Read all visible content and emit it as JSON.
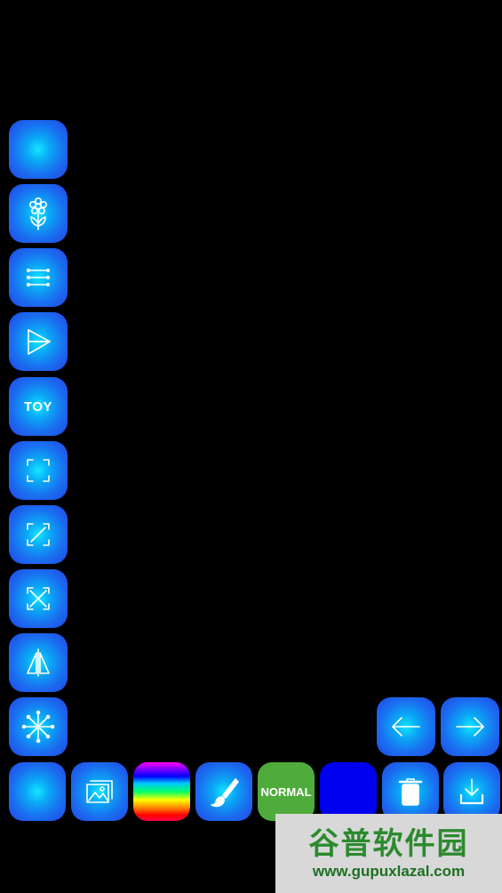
{
  "left_toolbar": {
    "items": [
      {
        "name": "plain-button",
        "icon": "glow-icon"
      },
      {
        "name": "flower-button",
        "icon": "flower-icon"
      },
      {
        "name": "lines-button",
        "icon": "lines-icon"
      },
      {
        "name": "triangle-button",
        "icon": "triangle-icon"
      },
      {
        "name": "toy-button",
        "label": "TOY"
      },
      {
        "name": "frame-button",
        "icon": "frame-corners-icon"
      },
      {
        "name": "expand-button",
        "icon": "expand-diagonal-icon"
      },
      {
        "name": "cross-button",
        "icon": "cross-expand-icon"
      },
      {
        "name": "mirror-button",
        "icon": "mirror-triangle-icon"
      },
      {
        "name": "burst-button",
        "icon": "burst-icon"
      }
    ]
  },
  "nav": {
    "back_icon": "arrow-left-icon",
    "forward_icon": "arrow-right-icon"
  },
  "bottom_toolbar": {
    "normal_label": "NORMAL",
    "current_color": "#0000f0",
    "icons": [
      "glow-icon",
      "gallery-icon",
      "rainbow-palette",
      "brush-icon",
      "normal-mode",
      "color-swatch",
      "trash-icon",
      "download-icon"
    ]
  },
  "watermark": {
    "title": "谷普软件园",
    "url": "www.gupuxlazal.com"
  }
}
